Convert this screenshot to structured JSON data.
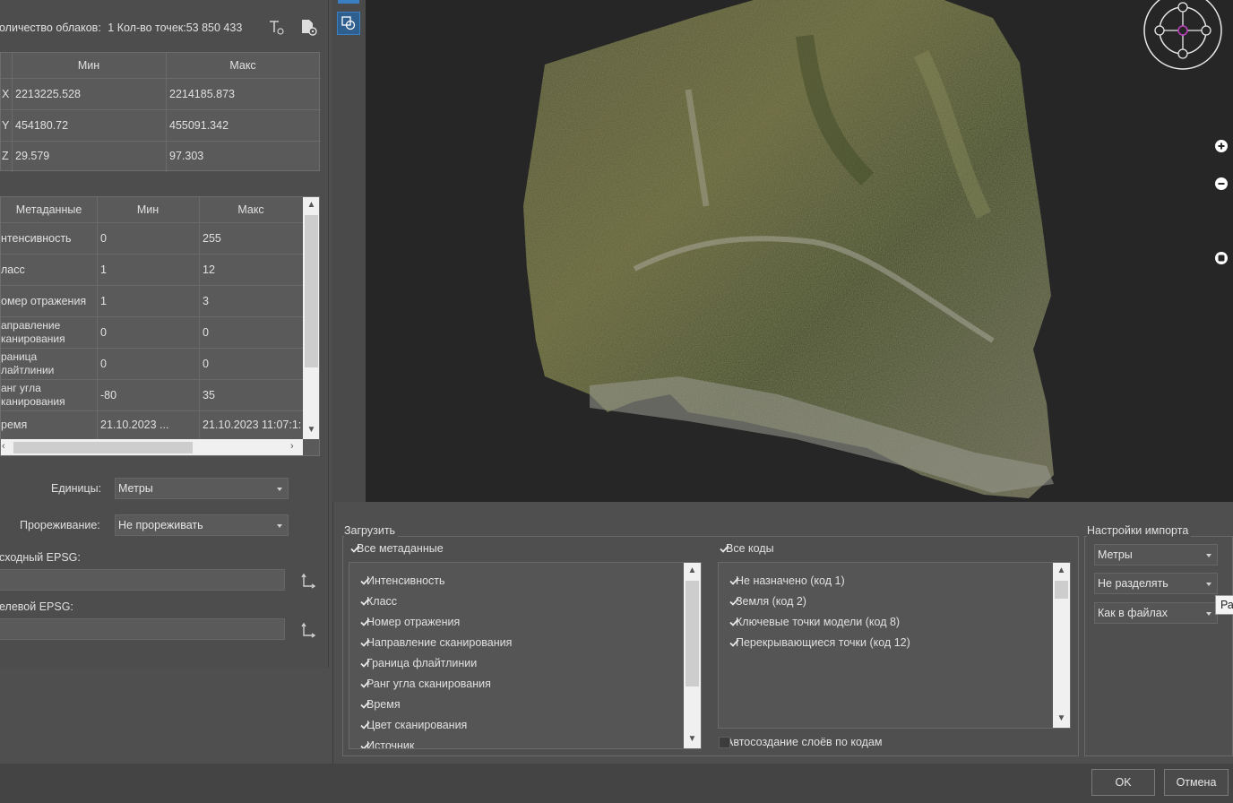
{
  "summary": {
    "clouds_label": "оличество облаков:",
    "clouds_value": "1 Кол-во точек:53 850 433"
  },
  "bounds_table": {
    "headers": [
      "",
      "Мин",
      "Макс"
    ],
    "rows": [
      {
        "axis": "X",
        "min": "2213225.528",
        "max": "2214185.873"
      },
      {
        "axis": "Y",
        "min": "454180.72",
        "max": "455091.342"
      },
      {
        "axis": "Z",
        "min": "29.579",
        "max": "97.303"
      }
    ]
  },
  "meta_table": {
    "headers": [
      "Метаданные",
      "Мин",
      "Макс"
    ],
    "rows": [
      {
        "name": "нтенсивность",
        "min": "0",
        "max": "255"
      },
      {
        "name": "ласс",
        "min": "1",
        "max": "12"
      },
      {
        "name": "омер отражения",
        "min": "1",
        "max": "3"
      },
      {
        "name": "аправление\nканирования",
        "min": "0",
        "max": "0"
      },
      {
        "name": "раница\nлайтлинии",
        "min": "0",
        "max": "0"
      },
      {
        "name": "анг угла\nканирования",
        "min": "-80",
        "max": "35"
      },
      {
        "name": "ремя",
        "min": "21.10.2023 ...",
        "max": "21.10.2023 11:07:1:"
      }
    ]
  },
  "units": {
    "label": "Единицы:",
    "value": "Метры"
  },
  "thinning": {
    "label": "Прореживание:",
    "value": "Не прореживать"
  },
  "src_epsg": {
    "label": "сходный EPSG:",
    "value": ""
  },
  "dst_epsg": {
    "label": "елевой EPSG:",
    "value": ""
  },
  "load_group": {
    "title": "Загрузить",
    "all_meta_label": "Все метаданные",
    "all_meta_checked": true,
    "meta_items": [
      {
        "label": "Интенсивность",
        "checked": true
      },
      {
        "label": "Класс",
        "checked": true
      },
      {
        "label": "Номер отражения",
        "checked": true
      },
      {
        "label": "Направление сканирования",
        "checked": true
      },
      {
        "label": "Граница флайтлинии",
        "checked": true
      },
      {
        "label": "Ранг угла сканирования",
        "checked": true
      },
      {
        "label": "Время",
        "checked": true
      },
      {
        "label": "Цвет сканирования",
        "checked": true
      },
      {
        "label": "Источник",
        "checked": true
      }
    ],
    "all_codes_label": "Все коды",
    "all_codes_checked": true,
    "code_items": [
      {
        "label": "Не назначено (код 1)",
        "checked": true
      },
      {
        "label": "Земля (код 2)",
        "checked": true
      },
      {
        "label": "Ключевые точки модели (код 8)",
        "checked": true
      },
      {
        "label": "Перекрывающиеся точки (код 12)",
        "checked": true
      }
    ],
    "auto_layers_label": "Автосоздание слоёв по кодам",
    "auto_layers_checked": false
  },
  "import_settings": {
    "title": "Настройки импорта",
    "units_value": "Метры",
    "split_value": "Не разделять",
    "as_files_value": "Как в файлах",
    "tooltip_fragment": "Ра"
  },
  "buttons": {
    "ok": "OK",
    "cancel": "Отмена"
  },
  "colors": {
    "background": "#4f4f4f",
    "viewport": "#262626",
    "accent": "#3a7fc1"
  }
}
